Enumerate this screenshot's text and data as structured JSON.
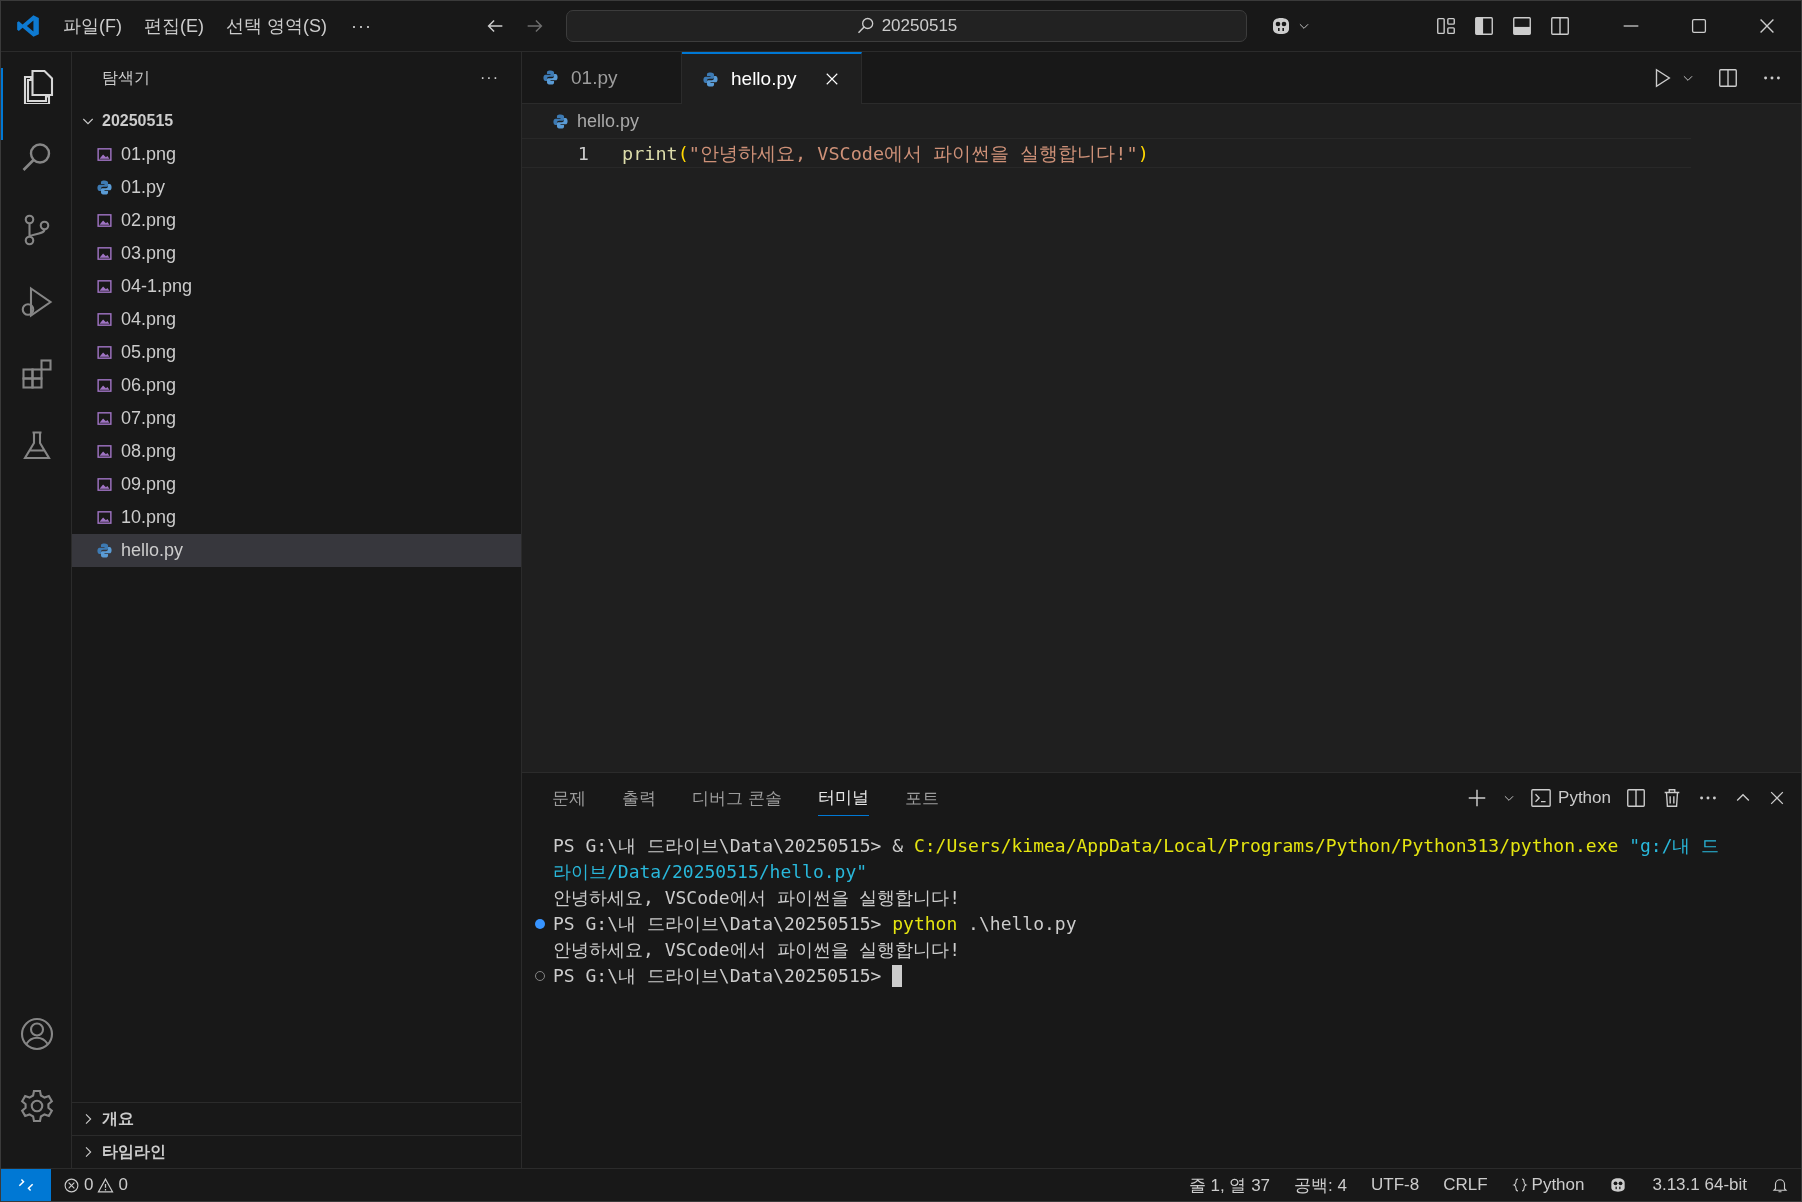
{
  "title_bar": {
    "menus": [
      "파일(F)",
      "편집(E)",
      "선택 영역(S)"
    ],
    "more": "···",
    "back_enabled": true,
    "forward_enabled": false,
    "search": "20250515"
  },
  "activity_bar": {
    "items": [
      {
        "kind": "files",
        "selected": true
      },
      {
        "kind": "search",
        "selected": false
      },
      {
        "kind": "git",
        "selected": false
      },
      {
        "kind": "debug",
        "selected": false
      },
      {
        "kind": "extensions",
        "selected": false
      },
      {
        "kind": "testing",
        "selected": false
      }
    ]
  },
  "sidebar": {
    "title": "탐색기",
    "more": "···",
    "folder": {
      "name": "20250515",
      "expanded": true,
      "children": [
        {
          "name": "01.png",
          "kind": "image",
          "selected": false
        },
        {
          "name": "01.py",
          "kind": "python",
          "selected": false
        },
        {
          "name": "02.png",
          "kind": "image",
          "selected": false
        },
        {
          "name": "03.png",
          "kind": "image",
          "selected": false
        },
        {
          "name": "04-1.png",
          "kind": "image",
          "selected": false
        },
        {
          "name": "04.png",
          "kind": "image",
          "selected": false
        },
        {
          "name": "05.png",
          "kind": "image",
          "selected": false
        },
        {
          "name": "06.png",
          "kind": "image",
          "selected": false
        },
        {
          "name": "07.png",
          "kind": "image",
          "selected": false
        },
        {
          "name": "08.png",
          "kind": "image",
          "selected": false
        },
        {
          "name": "09.png",
          "kind": "image",
          "selected": false
        },
        {
          "name": "10.png",
          "kind": "image",
          "selected": false
        },
        {
          "name": "hello.py",
          "kind": "python",
          "selected": true
        }
      ]
    },
    "sections": [
      {
        "label": "개요",
        "expanded": false
      },
      {
        "label": "타임라인",
        "expanded": false
      }
    ]
  },
  "editor": {
    "tabs": [
      {
        "label": "01.py",
        "selected": false
      },
      {
        "label": "hello.py",
        "selected": true
      }
    ],
    "breadcrumb": "hello.py",
    "lines": [
      {
        "number": "1",
        "tokens": [
          {
            "kind": "function",
            "text": "print"
          },
          {
            "kind": "paren",
            "text": "("
          },
          {
            "kind": "string",
            "text": "\"안녕하세요, VSCode에서 파이썬을 실행합니다!\""
          },
          {
            "kind": "paren",
            "text": ")"
          }
        ]
      }
    ]
  },
  "panel": {
    "tabs": [
      {
        "label": "문제",
        "selected": false
      },
      {
        "label": "출력",
        "selected": false
      },
      {
        "label": "디버그 콘솔",
        "selected": false
      },
      {
        "label": "터미널",
        "selected": true
      },
      {
        "label": "포트",
        "selected": false
      }
    ],
    "terminal_profile": "Python",
    "terminal": [
      {
        "marker": false,
        "cursor": false,
        "segments": [
          {
            "kind": "prompt",
            "text": "PS G:\\내 드라이브\\Data\\20250515> "
          },
          {
            "kind": "plain",
            "text": "& "
          },
          {
            "kind": "command",
            "text": "C:/Users/kimea/AppData/Local/Programs/Python/Python313/python.exe"
          },
          {
            "kind": "string",
            "text": "\"g:/내 드"
          }
        ]
      },
      {
        "marker": false,
        "cursor": false,
        "segments": [
          {
            "kind": "string",
            "text": "라이브/Data/20250515/hello.py\""
          }
        ]
      },
      {
        "marker": false,
        "cursor": false,
        "segments": [
          {
            "kind": "plain",
            "text": "안녕하세요, VSCode에서 파이썬을 실행합니다!"
          }
        ]
      },
      {
        "marker": true,
        "succeeded": true,
        "cursor": false,
        "segments": [
          {
            "kind": "prompt",
            "text": "PS G:\\내 드라이브\\Data\\20250515> "
          },
          {
            "kind": "command",
            "text": "python"
          },
          {
            "kind": "plain",
            "text": " .\\hello.py"
          }
        ]
      },
      {
        "marker": false,
        "cursor": false,
        "segments": [
          {
            "kind": "plain",
            "text": "안녕하세요, VSCode에서 파이썬을 실행합니다!"
          }
        ]
      },
      {
        "marker": true,
        "succeeded": false,
        "cursor": true,
        "segments": [
          {
            "kind": "prompt",
            "text": "PS G:\\내 드라이브\\Data\\20250515> "
          }
        ]
      }
    ]
  },
  "status_bar": {
    "errors": "0",
    "warnings": "0",
    "position": "줄 1, 열 37",
    "indent": "공백: 4",
    "encoding": "UTF-8",
    "eol": "CRLF",
    "language": "Python",
    "interpreter": "3.13.1 64-bit"
  }
}
